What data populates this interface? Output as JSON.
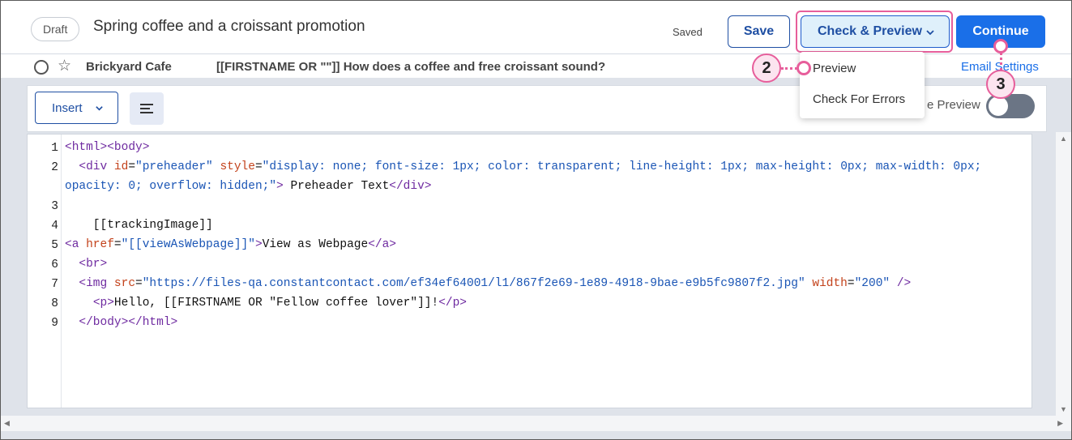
{
  "header": {
    "status_badge": "Draft",
    "campaign_title": "Spring coffee and a croissant promotion",
    "save_status": "Saved",
    "save_label": "Save",
    "check_preview_label": "Check & Preview",
    "continue_label": "Continue"
  },
  "subheader": {
    "sender": "Brickyard Cafe",
    "subject": "[[FIRSTNAME OR \"\"]] How does a coffee and free croissant sound?",
    "email_settings_label": "Email Settings"
  },
  "toolbar": {
    "insert_label": "Insert",
    "live_preview_label": "e Preview",
    "live_preview_on": false
  },
  "dropdown": {
    "items": [
      "Preview",
      "Check For Errors"
    ]
  },
  "callouts": {
    "step_preview": "2",
    "step_continue": "3"
  },
  "colors": {
    "accent": "#1a6fe8",
    "callout": "#e75e9b",
    "button_border": "#1f4fa3"
  },
  "editor": {
    "line_numbers": [
      "1",
      "2",
      "3",
      "4",
      "5",
      "6",
      "7",
      "8",
      "9"
    ],
    "lines": [
      {
        "segs": [
          [
            "tag",
            "<html><body>"
          ]
        ]
      },
      {
        "segs": [
          [
            "plain",
            "  "
          ],
          [
            "tag",
            "<div "
          ],
          [
            "attr",
            "id"
          ],
          [
            "plain",
            "="
          ],
          [
            "str",
            "\"preheader\""
          ],
          [
            "plain",
            " "
          ],
          [
            "attr",
            "style"
          ],
          [
            "plain",
            "="
          ],
          [
            "str",
            "\"display: none; font-size: 1px; color: transparent; line-height: 1px; max-height: 0px; max-width: 0px;"
          ]
        ]
      },
      {
        "segs": [
          [
            "str",
            "opacity: 0; overflow: hidden;\""
          ],
          [
            "tag",
            ">"
          ],
          [
            "plain",
            " Preheader Text"
          ],
          [
            "tag",
            "</div>"
          ]
        ]
      },
      {
        "segs": []
      },
      {
        "segs": [
          [
            "plain",
            "    [[trackingImage]]"
          ]
        ]
      },
      {
        "segs": [
          [
            "tag",
            "<a "
          ],
          [
            "attr",
            "href"
          ],
          [
            "plain",
            "="
          ],
          [
            "str",
            "\"[[viewAsWebpage]]\""
          ],
          [
            "tag",
            ">"
          ],
          [
            "plain",
            "View as Webpage"
          ],
          [
            "tag",
            "</a>"
          ]
        ]
      },
      {
        "segs": [
          [
            "plain",
            "  "
          ],
          [
            "tag",
            "<br>"
          ]
        ]
      },
      {
        "segs": [
          [
            "plain",
            "  "
          ],
          [
            "tag",
            "<img "
          ],
          [
            "attr",
            "src"
          ],
          [
            "plain",
            "="
          ],
          [
            "str",
            "\"https://files-qa.constantcontact.com/ef34ef64001/l1/867f2e69-1e89-4918-9bae-e9b5fc9807f2.jpg\""
          ],
          [
            "plain",
            " "
          ],
          [
            "attr",
            "width"
          ],
          [
            "plain",
            "="
          ],
          [
            "str",
            "\"200\""
          ],
          [
            "plain",
            " "
          ],
          [
            "tag",
            "/>"
          ]
        ]
      },
      {
        "segs": [
          [
            "plain",
            "    "
          ],
          [
            "tag",
            "<p>"
          ],
          [
            "plain",
            "Hello, [[FIRSTNAME OR \"Fellow coffee lover\"]]!"
          ],
          [
            "tag",
            "</p>"
          ]
        ]
      },
      {
        "segs": [
          [
            "plain",
            "  "
          ],
          [
            "tag",
            "</body></html>"
          ]
        ]
      }
    ]
  }
}
